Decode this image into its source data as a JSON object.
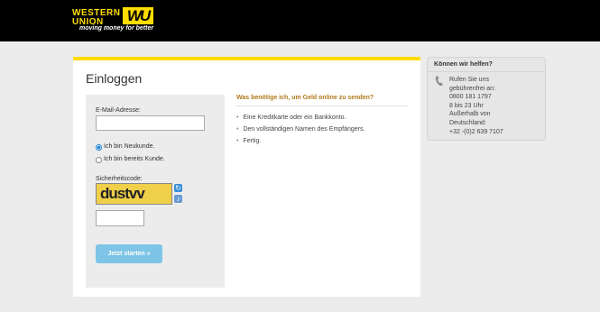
{
  "header": {
    "logo_line1": "WESTERN",
    "logo_line2": "UNION",
    "logo_mark": "WU",
    "tagline": "moving money for better"
  },
  "login": {
    "title": "Einloggen",
    "email_label": "E-Mail-Adresse:",
    "email_value": "",
    "radio_new": "Ich bin Neukunde.",
    "radio_existing": "Ich bin bereits Kunde.",
    "selected_radio": "new",
    "captcha_label": "Sicherheitscode:",
    "captcha_text": "dustvv",
    "captcha_input_value": "",
    "submit_label": "Jetzt starten »"
  },
  "info": {
    "title": "Was benötige ich, um Geld online zu senden?",
    "items": [
      "Eine Kreditkarte oder ein Bankkonto.",
      "Den vollständigen Namen des Empfängers.",
      "Fertig."
    ]
  },
  "help": {
    "title": "Können wir helfen?",
    "lines": [
      "Rufen Sie uns",
      "gebührenfrei an:",
      "0800 181 1797",
      "8 bis 23 Uhr",
      "Außerhalb von",
      "Deutschland:",
      "+32 -(0)2 639 7107"
    ]
  },
  "colors": {
    "brand_yellow": "#ffdd00",
    "header_bg": "#000000",
    "button": "#7ec4e6",
    "info_title": "#b07a1b"
  },
  "icons": {
    "refresh": "refresh-icon",
    "audio": "speaker-icon",
    "phone": "phone-icon"
  }
}
